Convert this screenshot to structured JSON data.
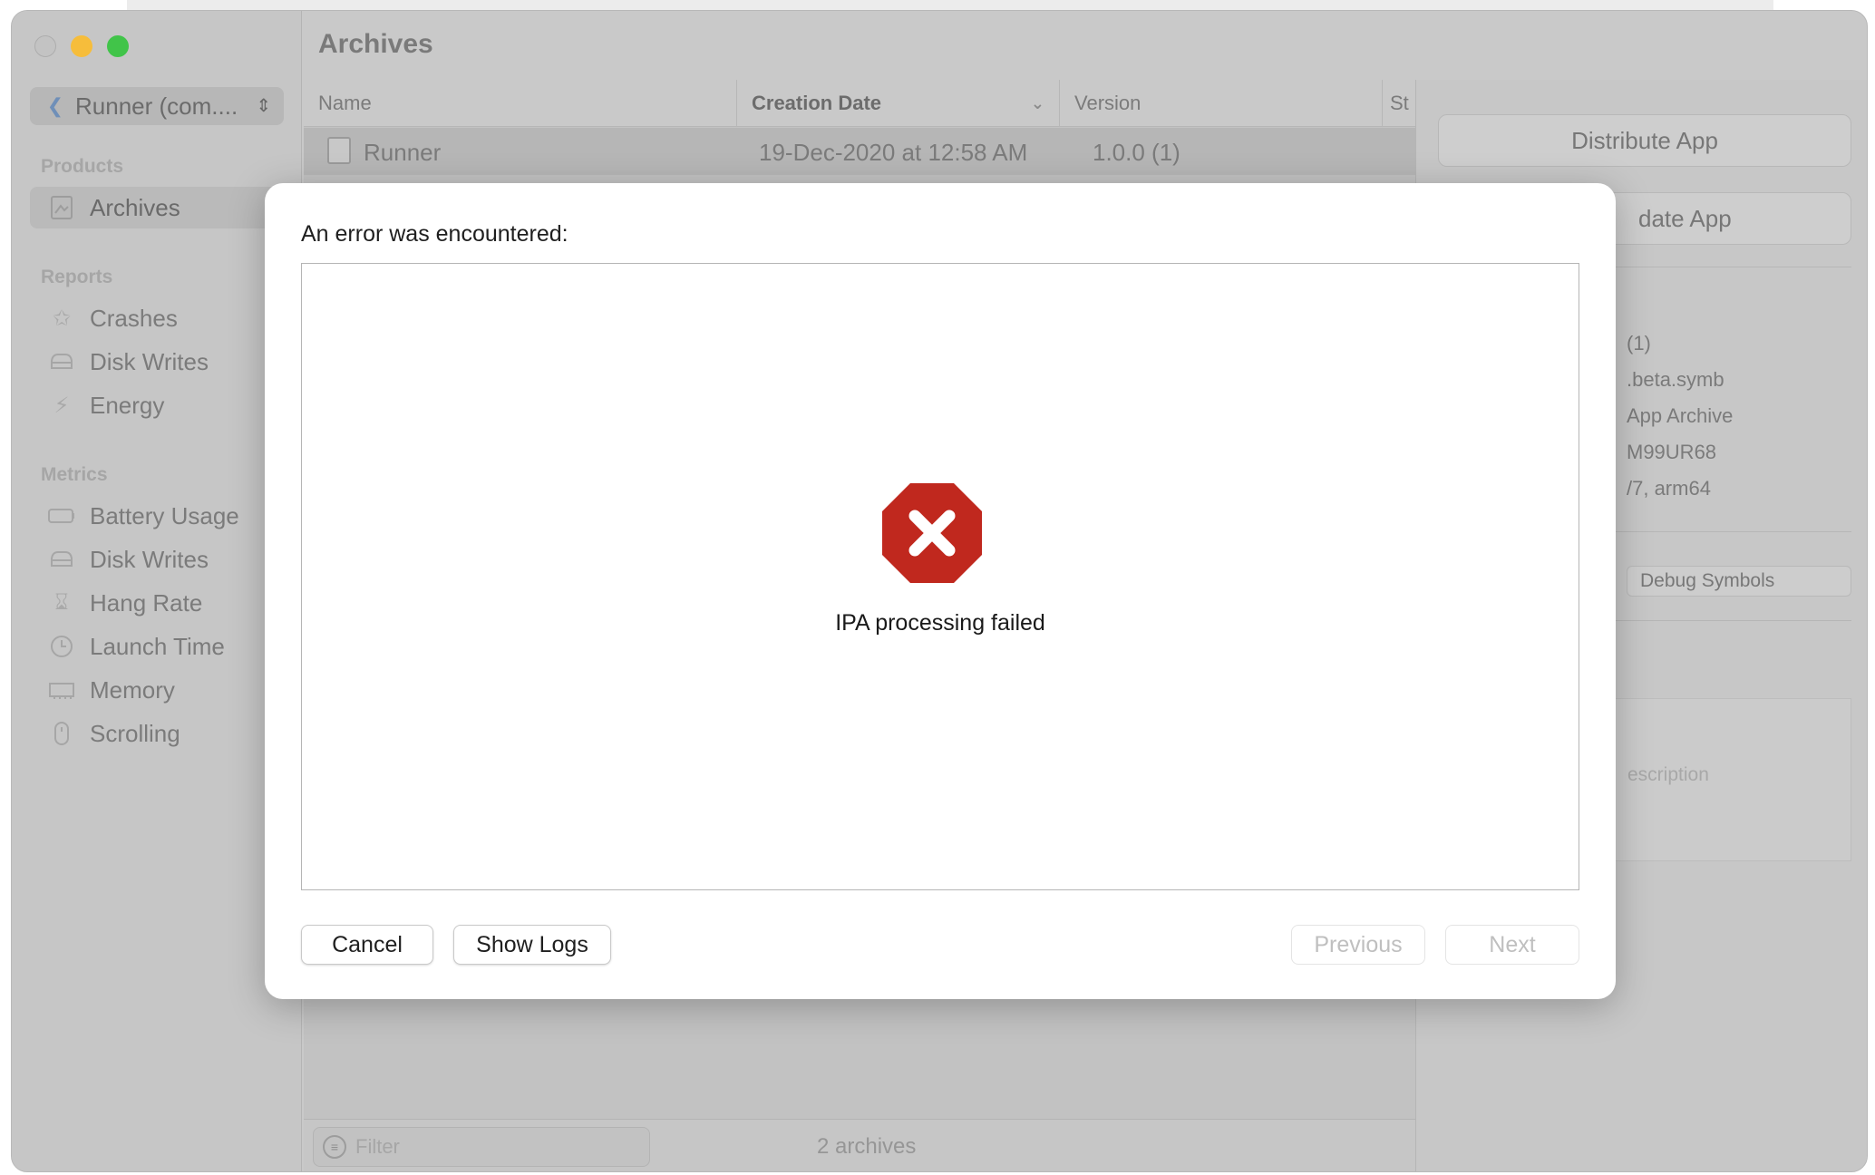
{
  "window": {
    "title": "Archives",
    "scheme_selector": "Runner (com....",
    "scheme_icon": "flutter-icon"
  },
  "sidebar": {
    "products": {
      "title": "Products",
      "items": [
        {
          "label": "Archives",
          "icon": "archive-icon",
          "selected": true
        }
      ]
    },
    "reports": {
      "title": "Reports",
      "items": [
        {
          "label": "Crashes",
          "icon": "crash-icon"
        },
        {
          "label": "Disk Writes",
          "icon": "disk-icon"
        },
        {
          "label": "Energy",
          "icon": "bolt-icon"
        }
      ]
    },
    "metrics": {
      "title": "Metrics",
      "items": [
        {
          "label": "Battery Usage",
          "icon": "battery-icon"
        },
        {
          "label": "Disk Writes",
          "icon": "disk-icon"
        },
        {
          "label": "Hang Rate",
          "icon": "hourglass-icon"
        },
        {
          "label": "Launch Time",
          "icon": "clock-icon"
        },
        {
          "label": "Memory",
          "icon": "memory-chip-icon"
        },
        {
          "label": "Scrolling",
          "icon": "scroll-icon"
        }
      ]
    }
  },
  "table": {
    "columns": [
      "Name",
      "Creation Date",
      "Version",
      "St"
    ],
    "rows": [
      {
        "name": "Runner",
        "date": "19-Dec-2020 at 12:58 AM",
        "version": "1.0.0 (1)"
      }
    ]
  },
  "bottom": {
    "filter_placeholder": "Filter",
    "count": "2 archives"
  },
  "right_panel": {
    "distribute_button": "Distribute App",
    "validate_button_partial": "date App",
    "info_lines": [
      "(1)",
      ".beta.symb",
      "App Archive",
      "M99UR68",
      "/7, arm64"
    ],
    "debug_symbols_button": "Debug Symbols",
    "description_placeholder_partial": "escription"
  },
  "dialog": {
    "title": "An error was encountered:",
    "error_message": "IPA processing failed",
    "error_icon": "error-stop-icon",
    "error_color": "#c0281e",
    "buttons": {
      "cancel": "Cancel",
      "show_logs": "Show Logs",
      "previous": "Previous",
      "next": "Next"
    }
  }
}
